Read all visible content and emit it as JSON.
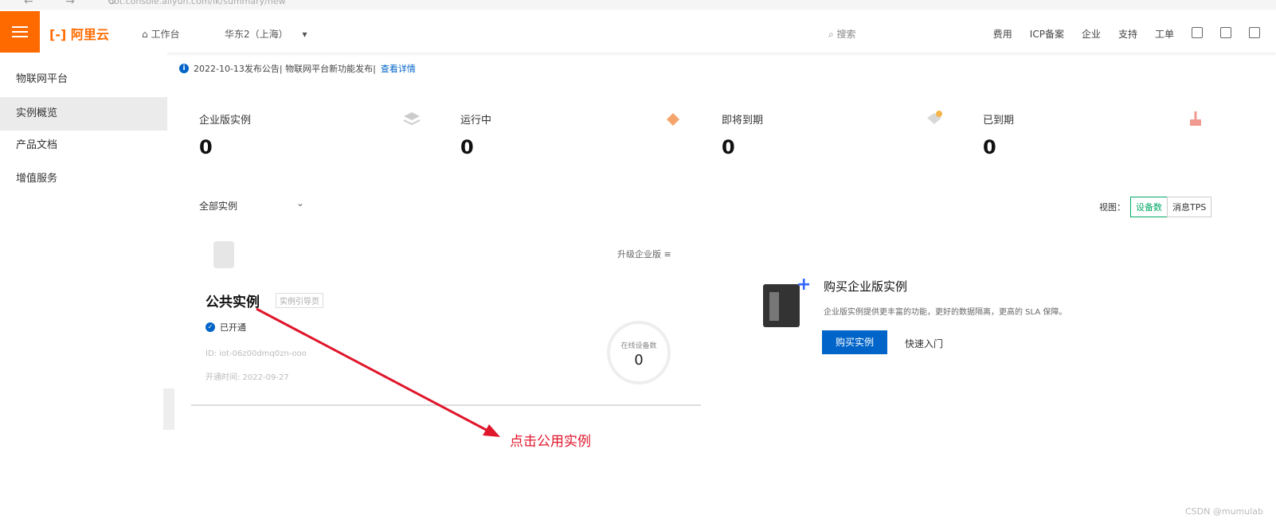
{
  "browser": {
    "nav_glyphs": "← → ↻",
    "address": "iot.console.aliyun.com/lk/summary/new"
  },
  "topbar": {
    "logo": "[-] 阿里云",
    "workbench": "工作台",
    "region": "华东2（上海）",
    "search_placeholder": "搜索",
    "right_items": [
      "费用",
      "ICP备案",
      "企业",
      "支持",
      "工单"
    ]
  },
  "sidebar": {
    "title": "物联网平台",
    "items": [
      {
        "label": "实例概览",
        "active": true
      },
      {
        "label": "产品文档",
        "active": false
      },
      {
        "label": "增值服务",
        "active": false
      }
    ]
  },
  "notice": {
    "text": "2022-10-13发布公告| 物联网平台新功能发布|",
    "link": "查看详情"
  },
  "stats": [
    {
      "label": "企业版实例",
      "value": "0"
    },
    {
      "label": "运行中",
      "value": "0"
    },
    {
      "label": "即将到期",
      "value": "0"
    },
    {
      "label": "已到期",
      "value": "0"
    }
  ],
  "filter": {
    "selected": "全部实例"
  },
  "view": {
    "label": "视图：",
    "options": [
      "设备数",
      "消息TPS"
    ],
    "selected": "设备数"
  },
  "card": {
    "title": "公共实例",
    "tag": "实例引导页",
    "more": "升级企业版",
    "status": "已开通",
    "meta1": "ID: iot-06z00dmq0zn-ooo",
    "meta2": "开通时间: 2022-09-27",
    "ring_label": "在线设备数",
    "ring_value": "0"
  },
  "promo": {
    "title": "购买企业版实例",
    "desc": "企业版实例提供更丰富的功能，更好的数据隔离，更高的 SLA 保障。",
    "buy": "购买实例",
    "quick": "快速入门"
  },
  "annotation": {
    "text": "点击公用实例"
  },
  "watermark": "CSDN @mumulab"
}
